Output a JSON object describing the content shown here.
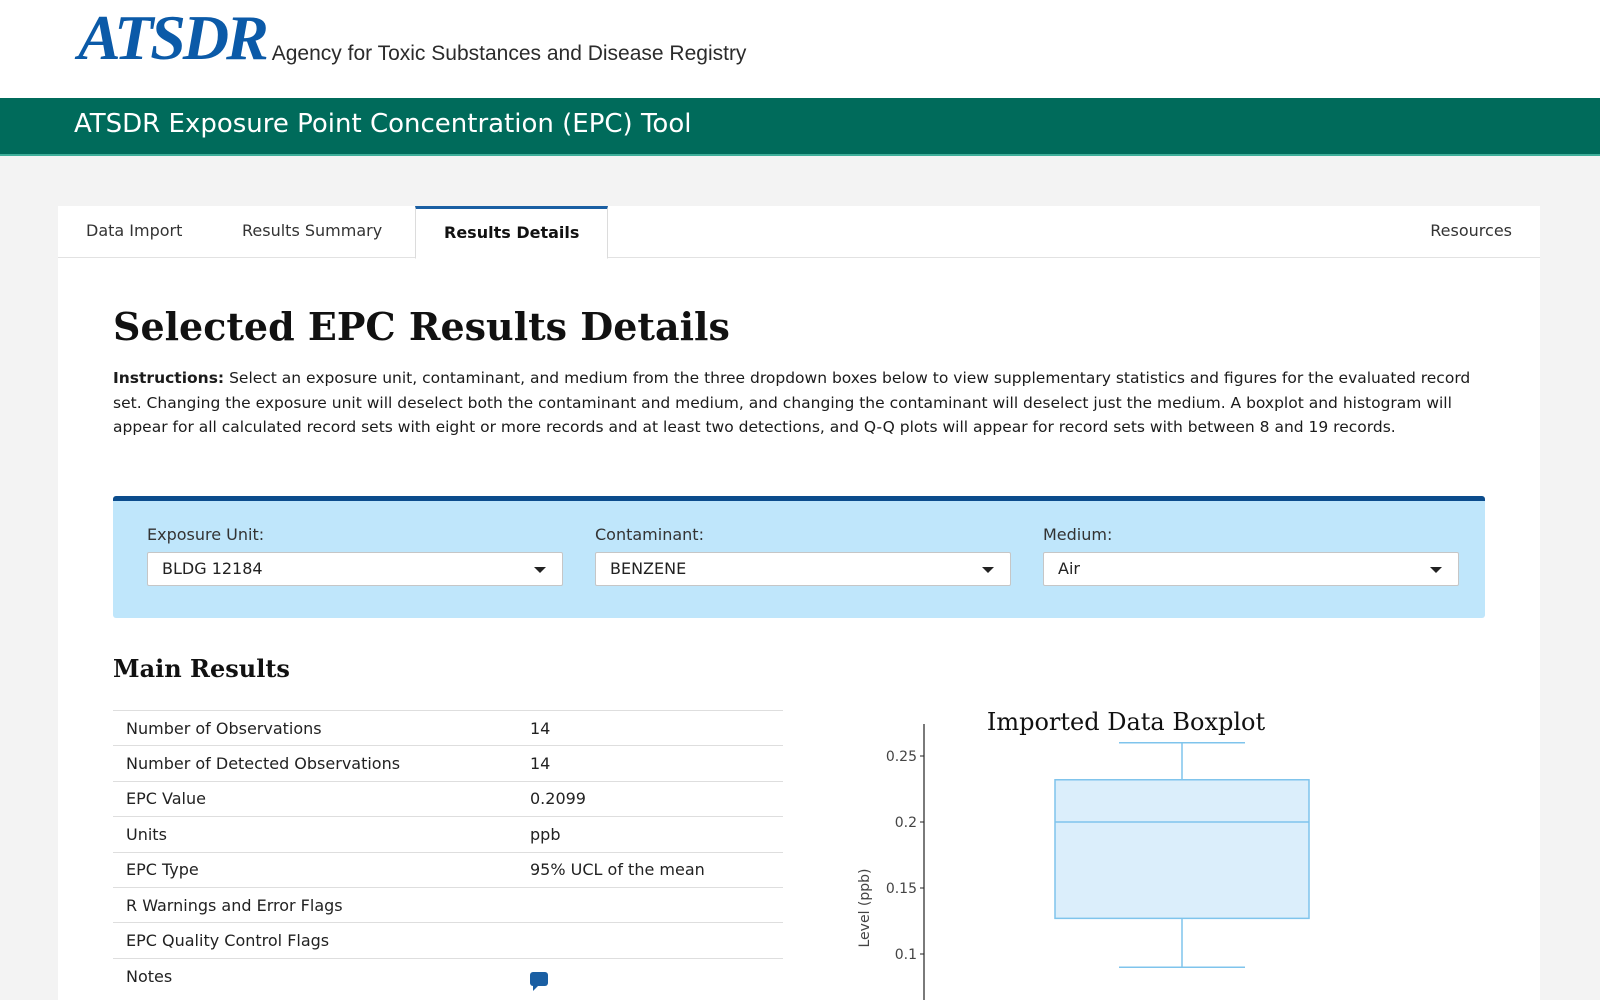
{
  "header": {
    "logo_mark": "ATSDR",
    "logo_subtitle": "Agency for Toxic Substances and Disease Registry",
    "banner_title": "ATSDR Exposure Point Concentration (EPC) Tool"
  },
  "tabs": {
    "data_import": "Data Import",
    "results_summary": "Results Summary",
    "results_details": "Results Details",
    "resources": "Resources",
    "active": "Results Details"
  },
  "page": {
    "title": "Selected EPC Results Details",
    "instructions_label": "Instructions:",
    "instructions_text": " Select an exposure unit, contaminant, and medium from the three dropdown boxes below to view supplementary statistics and figures for the evaluated record set. Changing the exposure unit will deselect both the contaminant and medium, and changing the contaminant will deselect just the medium. A boxplot and histogram will appear for all calculated record sets with eight or more records and at least two detections, and Q-Q plots will appear for record sets with between 8 and 19 records."
  },
  "filters": {
    "exposure_unit": {
      "label": "Exposure Unit:",
      "value": "BLDG 12184"
    },
    "contaminant": {
      "label": "Contaminant:",
      "value": "BENZENE"
    },
    "medium": {
      "label": "Medium:",
      "value": "Air"
    }
  },
  "main_results": {
    "title": "Main Results",
    "rows": [
      {
        "label": "Number of Observations",
        "value": "14"
      },
      {
        "label": "Number of Detected Observations",
        "value": "14"
      },
      {
        "label": "EPC Value",
        "value": "0.2099"
      },
      {
        "label": "Units",
        "value": "ppb"
      },
      {
        "label": "EPC Type",
        "value": "95% UCL of the mean"
      },
      {
        "label": "R Warnings and Error Flags",
        "value": ""
      },
      {
        "label": "EPC Quality Control Flags",
        "value": ""
      },
      {
        "label": "Notes",
        "value": ""
      }
    ],
    "notes_icon": "comment-icon"
  },
  "chart_data": {
    "type": "box",
    "title": "Imported Data Boxplot",
    "ylabel": "Level (ppb)",
    "yticks": [
      "0.1",
      "0.15",
      "0.2",
      "0.25"
    ],
    "ylim": [
      0.0,
      0.275
    ],
    "box": {
      "min": 0.09,
      "q1": 0.127,
      "median": 0.2,
      "q3": 0.232,
      "max": 0.26
    },
    "fill_color": "#dbeefb",
    "stroke_color": "#7fc4ec"
  }
}
